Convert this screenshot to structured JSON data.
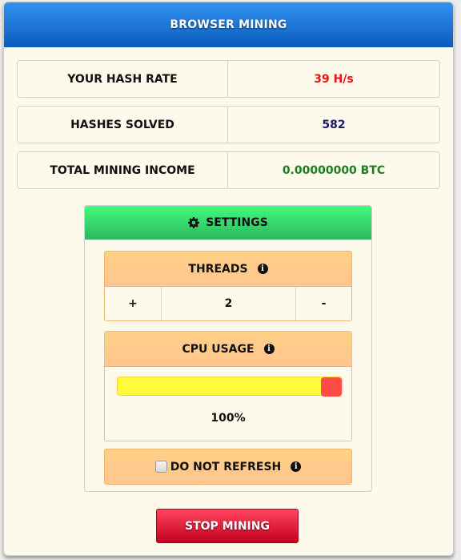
{
  "header": {
    "title": "BROWSER MINING"
  },
  "stats": [
    {
      "label": "YOUR HASH RATE",
      "value": "39 H/s",
      "color": "#ee1111"
    },
    {
      "label": "HASHES SOLVED",
      "value": "582",
      "color": "#1a1a6e"
    },
    {
      "label": "TOTAL MINING INCOME",
      "value": "0.00000000 BTC",
      "color": "#1f7f1f"
    }
  ],
  "settings": {
    "title": "SETTINGS",
    "icon": "gear-icon",
    "threads": {
      "label": "THREADS",
      "plus_label": "+",
      "value": "2",
      "minus_label": "-"
    },
    "cpu": {
      "label": "CPU USAGE",
      "percent": 100,
      "percent_label": "100%"
    },
    "do_not_refresh": {
      "label": "DO NOT REFRESH",
      "checked": false
    }
  },
  "actions": {
    "stop_label": "STOP MINING"
  },
  "colors": {
    "header": "#1a73d8",
    "settings_header": "#3be074",
    "orange": "#ffc98a",
    "stop": "#e0102e",
    "slider": "#fffb3b",
    "handle": "#ff4c47"
  }
}
